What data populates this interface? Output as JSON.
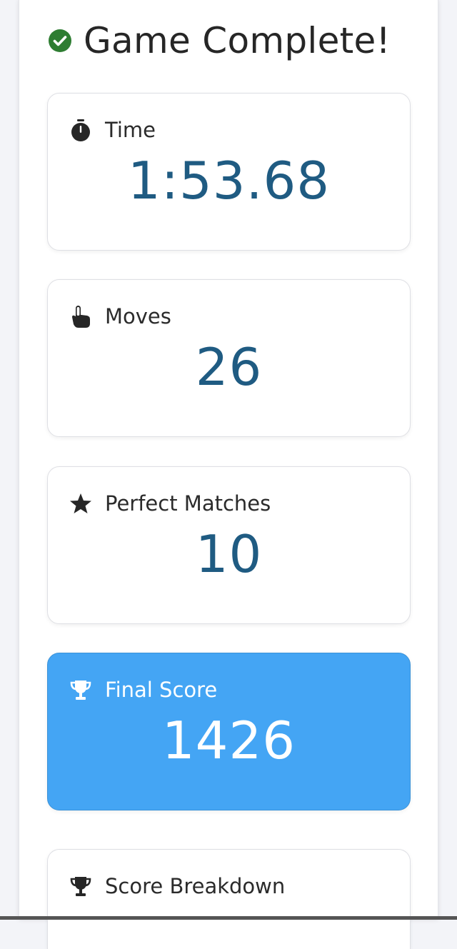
{
  "header": {
    "title": "Game Complete!",
    "icon": "check-circle-icon",
    "icon_color": "#2e7d32"
  },
  "stats": {
    "time": {
      "label": "Time",
      "value": "1:53.68",
      "icon": "stopwatch-icon"
    },
    "moves": {
      "label": "Moves",
      "value": "26",
      "icon": "pointing-hand-icon"
    },
    "perfect": {
      "label": "Perfect Matches",
      "value": "10",
      "icon": "star-icon"
    },
    "final": {
      "label": "Final Score",
      "value": "1426",
      "icon": "trophy-icon",
      "bg_color": "#44a5f4"
    },
    "breakdown": {
      "label": "Score Breakdown",
      "icon": "trophy-icon"
    }
  },
  "colors": {
    "value_text": "#1f5b82",
    "highlight": "#44a5f4"
  }
}
